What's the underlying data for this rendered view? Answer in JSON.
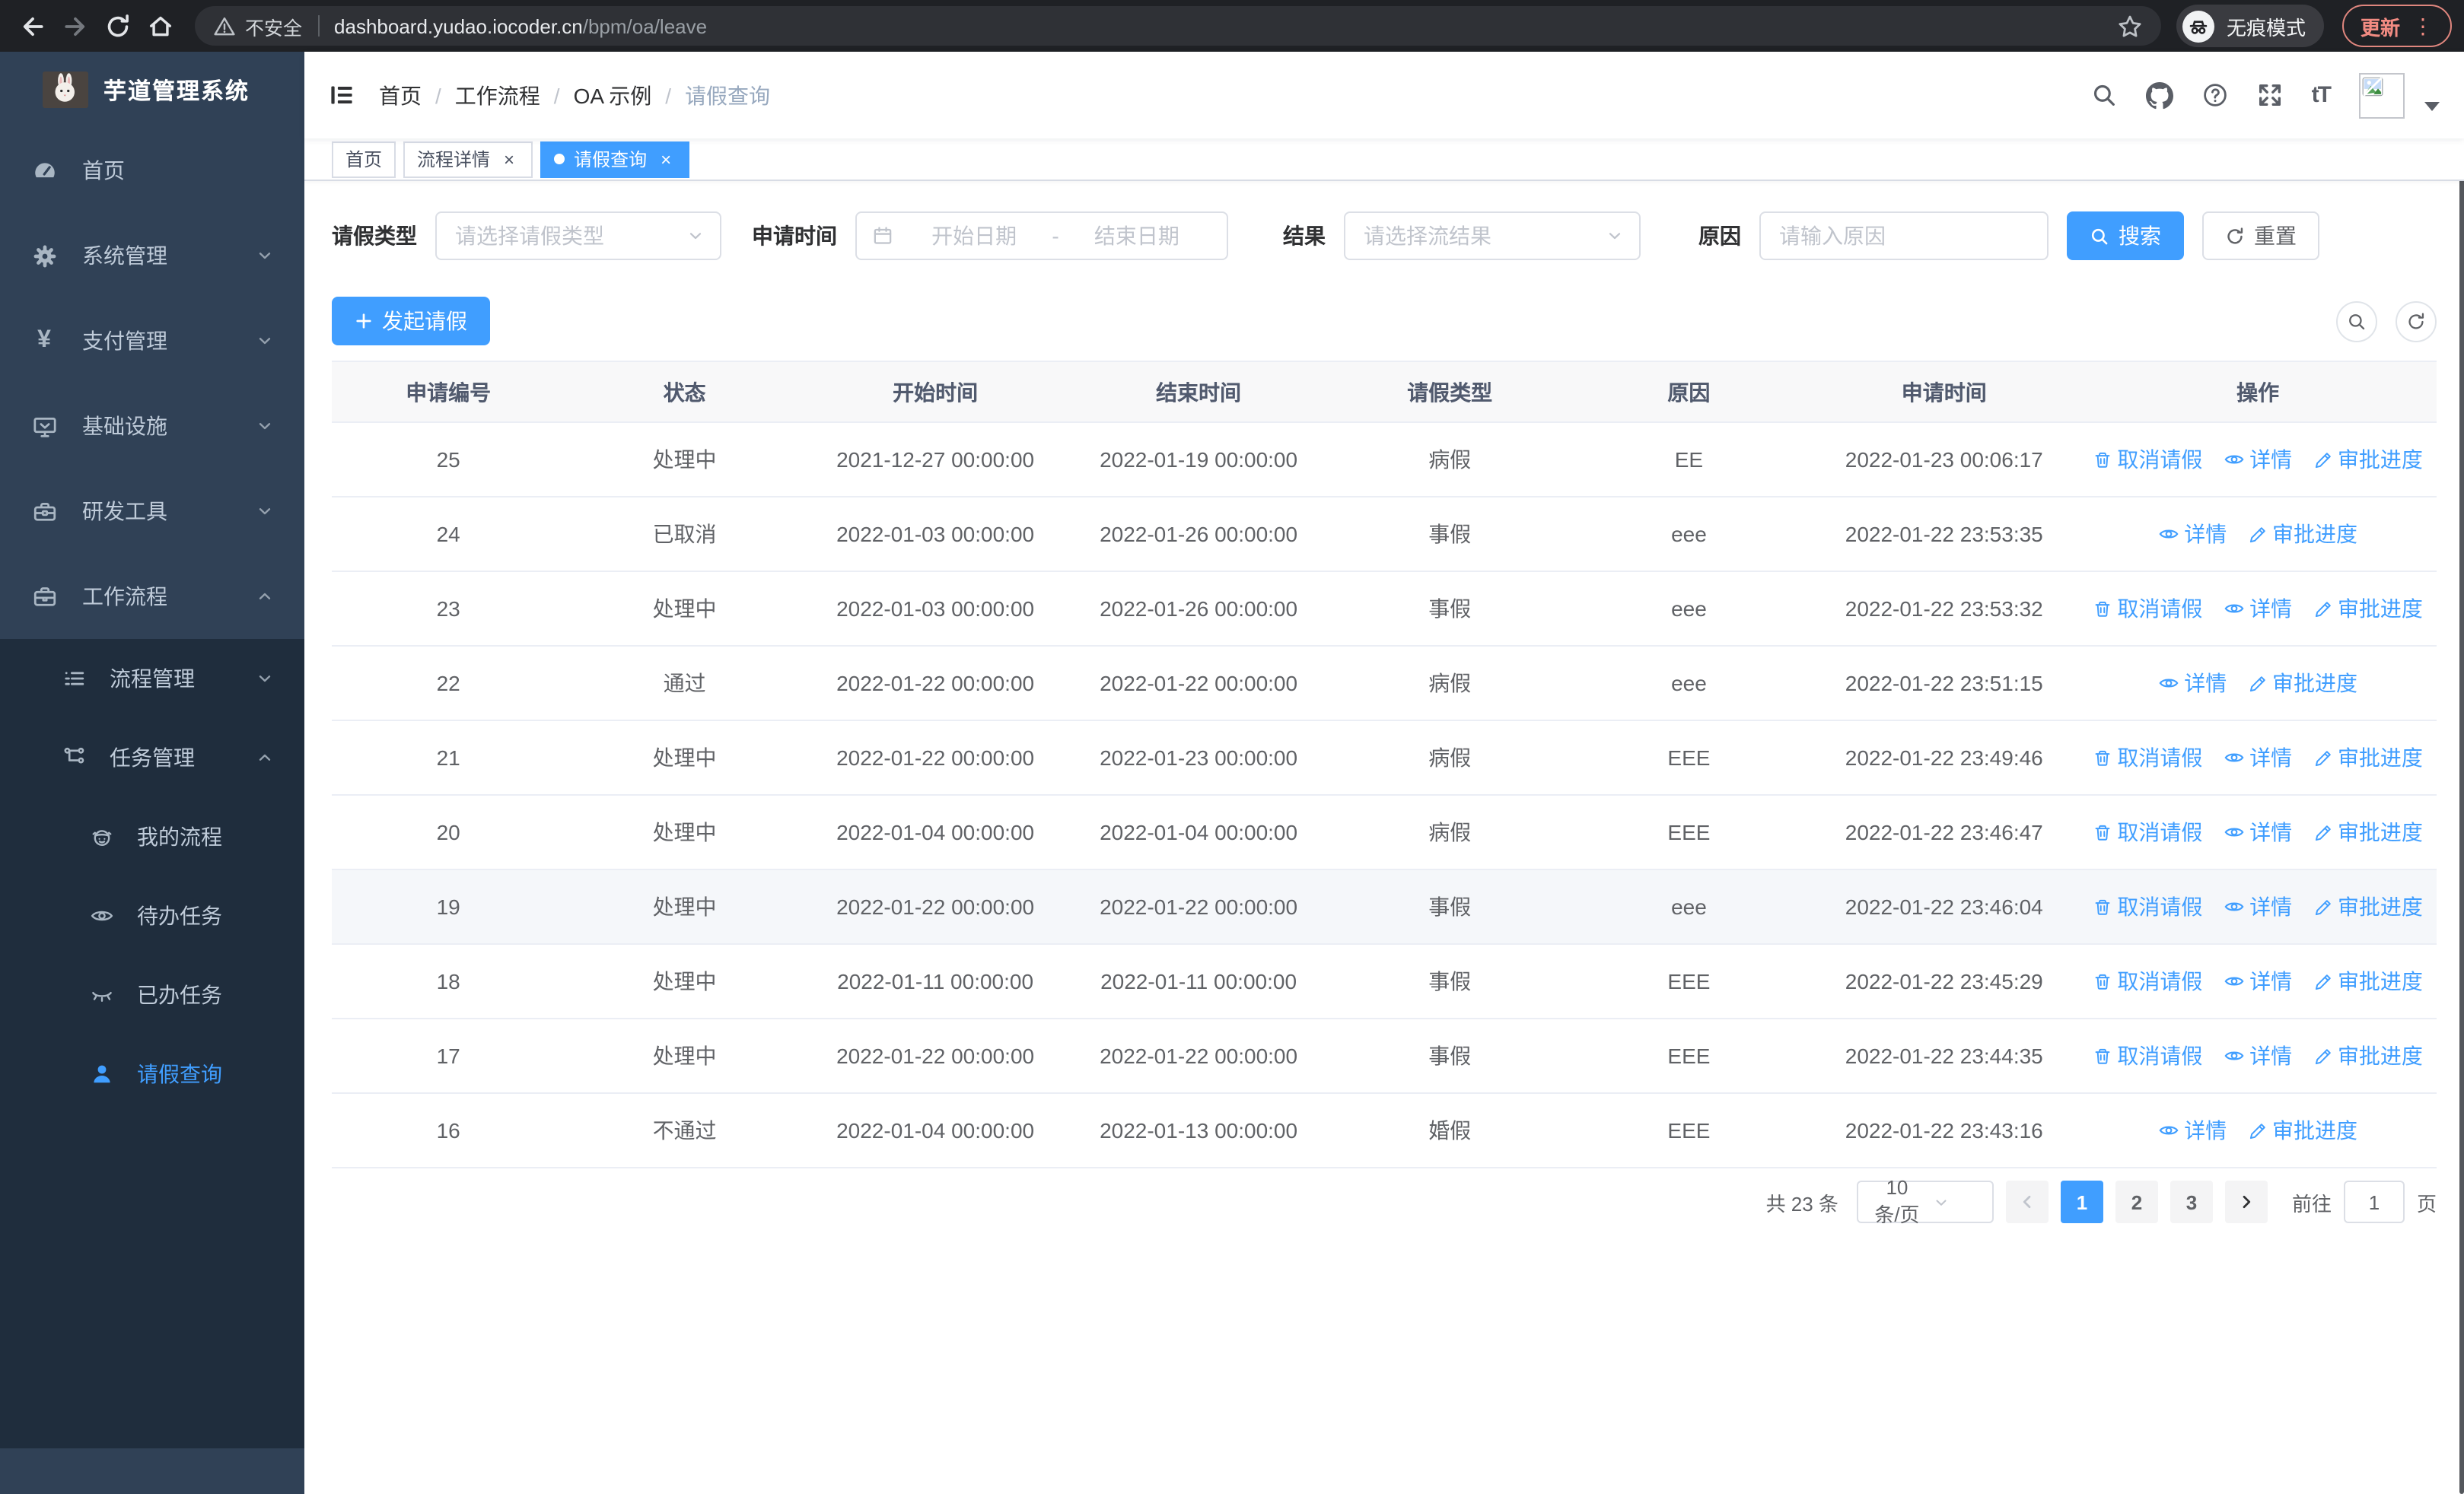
{
  "browser": {
    "insecure_label": "不安全",
    "url_host": "dashboard.yudao.iocoder.cn",
    "url_path": "/bpm/oa/leave",
    "incognito_label": "无痕模式",
    "update_label": "更新",
    "menu_dots": "⋮"
  },
  "colors": {
    "accent": "#409eff",
    "sidebar_bg": "#304156",
    "sidebar_submenu_bg": "#1f2d3d",
    "update_red": "#f28b82"
  },
  "sidebar": {
    "title": "芋道管理系统",
    "items": [
      {
        "label": "首页"
      },
      {
        "label": "系统管理"
      },
      {
        "label": "支付管理"
      },
      {
        "label": "基础设施"
      },
      {
        "label": "研发工具"
      },
      {
        "label": "工作流程"
      }
    ],
    "workflow_children": [
      {
        "label": "流程管理"
      },
      {
        "label": "任务管理"
      }
    ],
    "task_children": [
      {
        "label": "我的流程"
      },
      {
        "label": "待办任务"
      },
      {
        "label": "已办任务"
      },
      {
        "label": "请假查询"
      }
    ]
  },
  "navbar": {
    "breadcrumb": [
      "首页",
      "工作流程",
      "OA 示例",
      "请假查询"
    ]
  },
  "tabs": {
    "items": [
      {
        "label": "首页"
      },
      {
        "label": "流程详情"
      },
      {
        "label": "请假查询"
      }
    ]
  },
  "filters": {
    "type_label": "请假类型",
    "type_placeholder": "请选择请假类型",
    "time_label": "申请时间",
    "start_placeholder": "开始日期",
    "range_separator": "-",
    "end_placeholder": "结束日期",
    "result_label": "结果",
    "result_placeholder": "请选择流结果",
    "reason_label": "原因",
    "reason_placeholder": "请输入原因",
    "search_label": "搜索",
    "reset_label": "重置"
  },
  "toolbar": {
    "create_label": "发起请假"
  },
  "table": {
    "columns": [
      "申请编号",
      "状态",
      "开始时间",
      "结束时间",
      "请假类型",
      "原因",
      "申请时间",
      "操作"
    ],
    "action_labels": {
      "cancel": "取消请假",
      "detail": "详情",
      "progress": "审批进度"
    },
    "rows": [
      {
        "id": "25",
        "status": "处理中",
        "start": "2021-12-27 00:00:00",
        "end": "2022-01-19 00:00:00",
        "type": "病假",
        "reason": "EE",
        "apply": "2022-01-23 00:06:17",
        "actions": [
          "cancel",
          "detail",
          "progress"
        ],
        "highlight": false
      },
      {
        "id": "24",
        "status": "已取消",
        "start": "2022-01-03 00:00:00",
        "end": "2022-01-26 00:00:00",
        "type": "事假",
        "reason": "eee",
        "apply": "2022-01-22 23:53:35",
        "actions": [
          "detail",
          "progress"
        ],
        "highlight": false
      },
      {
        "id": "23",
        "status": "处理中",
        "start": "2022-01-03 00:00:00",
        "end": "2022-01-26 00:00:00",
        "type": "事假",
        "reason": "eee",
        "apply": "2022-01-22 23:53:32",
        "actions": [
          "cancel",
          "detail",
          "progress"
        ],
        "highlight": false
      },
      {
        "id": "22",
        "status": "通过",
        "start": "2022-01-22 00:00:00",
        "end": "2022-01-22 00:00:00",
        "type": "病假",
        "reason": "eee",
        "apply": "2022-01-22 23:51:15",
        "actions": [
          "detail",
          "progress"
        ],
        "highlight": false
      },
      {
        "id": "21",
        "status": "处理中",
        "start": "2022-01-22 00:00:00",
        "end": "2022-01-23 00:00:00",
        "type": "病假",
        "reason": "EEE",
        "apply": "2022-01-22 23:49:46",
        "actions": [
          "cancel",
          "detail",
          "progress"
        ],
        "highlight": false
      },
      {
        "id": "20",
        "status": "处理中",
        "start": "2022-01-04 00:00:00",
        "end": "2022-01-04 00:00:00",
        "type": "病假",
        "reason": "EEE",
        "apply": "2022-01-22 23:46:47",
        "actions": [
          "cancel",
          "detail",
          "progress"
        ],
        "highlight": false
      },
      {
        "id": "19",
        "status": "处理中",
        "start": "2022-01-22 00:00:00",
        "end": "2022-01-22 00:00:00",
        "type": "事假",
        "reason": "eee",
        "apply": "2022-01-22 23:46:04",
        "actions": [
          "cancel",
          "detail",
          "progress"
        ],
        "highlight": true
      },
      {
        "id": "18",
        "status": "处理中",
        "start": "2022-01-11 00:00:00",
        "end": "2022-01-11 00:00:00",
        "type": "事假",
        "reason": "EEE",
        "apply": "2022-01-22 23:45:29",
        "actions": [
          "cancel",
          "detail",
          "progress"
        ],
        "highlight": false
      },
      {
        "id": "17",
        "status": "处理中",
        "start": "2022-01-22 00:00:00",
        "end": "2022-01-22 00:00:00",
        "type": "事假",
        "reason": "EEE",
        "apply": "2022-01-22 23:44:35",
        "actions": [
          "cancel",
          "detail",
          "progress"
        ],
        "highlight": false
      },
      {
        "id": "16",
        "status": "不通过",
        "start": "2022-01-04 00:00:00",
        "end": "2022-01-13 00:00:00",
        "type": "婚假",
        "reason": "EEE",
        "apply": "2022-01-22 23:43:16",
        "actions": [
          "detail",
          "progress"
        ],
        "highlight": false
      }
    ]
  },
  "pagination": {
    "total_label": "共 23 条",
    "size_label": "10条/页",
    "pages": [
      "1",
      "2",
      "3"
    ],
    "goto_label": "前往",
    "goto_value": "1",
    "unit_label": "页"
  }
}
